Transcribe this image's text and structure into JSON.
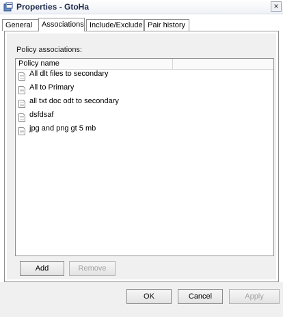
{
  "window": {
    "title": "Properties - GtoHa",
    "close_glyph": "×"
  },
  "tabs": [
    {
      "label": "General"
    },
    {
      "label": "Associations",
      "active": true
    },
    {
      "label": "Include/Exclude"
    },
    {
      "label": "Pair history"
    }
  ],
  "associations": {
    "section_label": "Policy associations:",
    "column_header": "Policy name",
    "items": [
      {
        "name": "All dlt files to secondary"
      },
      {
        "name": "All to Primary"
      },
      {
        "name": "all txt doc odt to secondary"
      },
      {
        "name": "dsfdsaf"
      },
      {
        "name": "jpg and png gt 5 mb"
      }
    ],
    "add_label": "Add",
    "remove_label": "Remove"
  },
  "footer": {
    "ok_label": "OK",
    "cancel_label": "Cancel",
    "apply_label": "Apply"
  },
  "icons": {
    "app": "properties-window-icon",
    "list_item": "document-icon"
  },
  "colors": {
    "border": "#8f8f8f",
    "panel_bg": "#f0f0f0",
    "disabled_text": "#a3a3a3"
  }
}
